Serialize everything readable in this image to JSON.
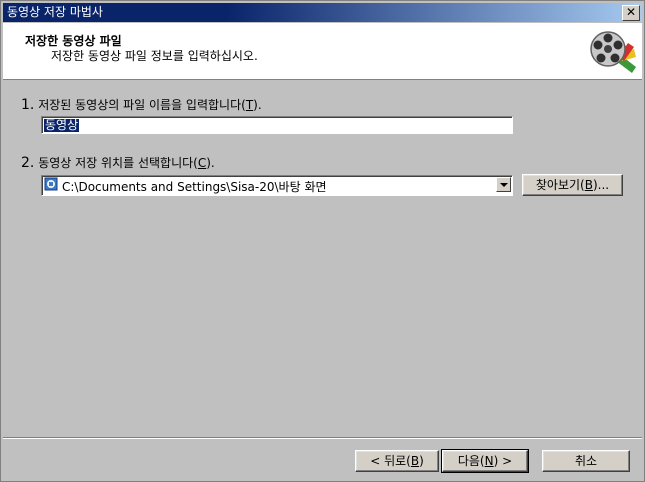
{
  "window": {
    "title": "동영상 저장 마법사",
    "close_label": "x"
  },
  "header": {
    "title": "저장한 동영상 파일",
    "subtitle": "저장한 동영상 파일 정보를 입력하십시오."
  },
  "step1": {
    "number": "1.",
    "text_before": "저장된 동영상의 파일 이름을 입력합니다(",
    "accel": "T",
    "text_after": ").",
    "value": "동영상"
  },
  "step2": {
    "number": "2.",
    "text_before": "동영상 저장 위치를 선택합니다(",
    "accel": "C",
    "text_after": ").",
    "value": "C:\\Documents and Settings\\Sisa-20\\바탕 화면",
    "browse_before": "찾아보기(",
    "browse_accel": "B",
    "browse_after": ")..."
  },
  "buttons": {
    "back_before": "< 뒤로(",
    "back_accel": "B",
    "back_after": ")",
    "next_before": "다음(",
    "next_accel": "N",
    "next_after": ") >",
    "cancel": "취소"
  },
  "icons": {
    "logo": "film-reel-icon",
    "folder": "folder-icon",
    "dropdown": "chevron-down-icon"
  }
}
